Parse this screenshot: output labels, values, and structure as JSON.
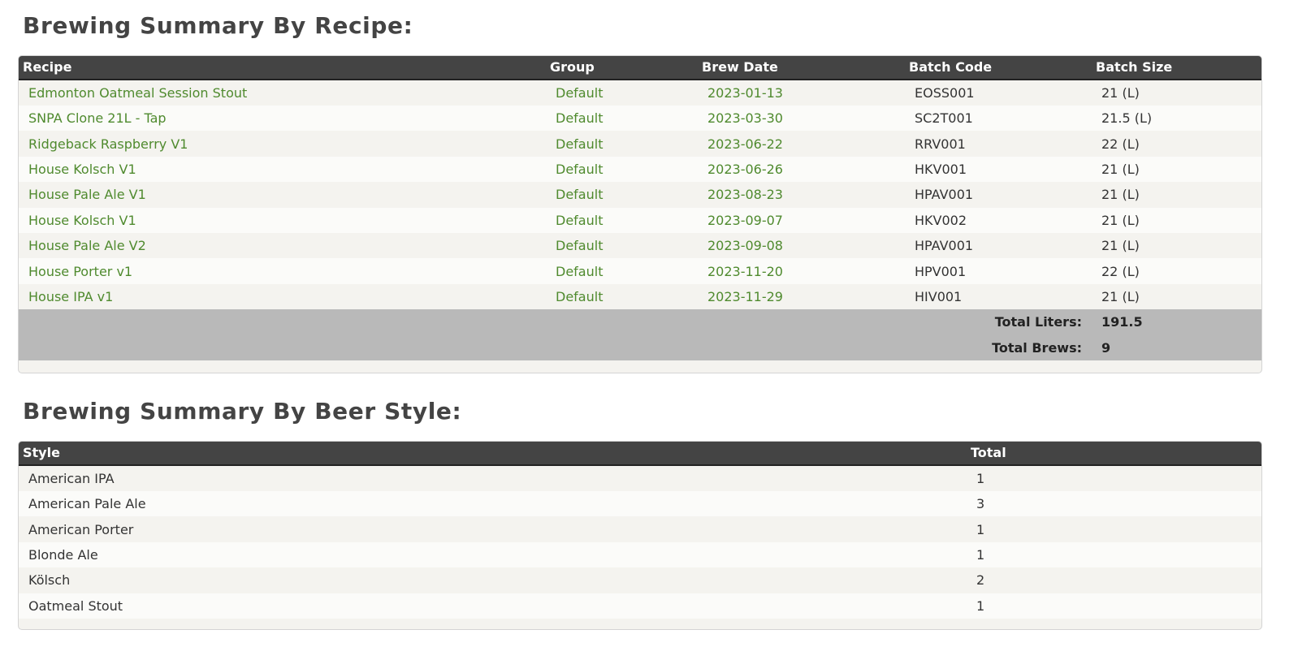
{
  "recipe_section": {
    "title": "Brewing Summary By Recipe:",
    "columns": {
      "recipe": "Recipe",
      "group": "Group",
      "brew_date": "Brew Date",
      "batch_code": "Batch Code",
      "batch_size": "Batch Size"
    },
    "rows": [
      {
        "recipe": "Edmonton Oatmeal Session Stout",
        "group": "Default",
        "brew_date": "2023-01-13",
        "batch_code": "EOSS001",
        "batch_size": "21 (L)"
      },
      {
        "recipe": "SNPA Clone 21L - Tap",
        "group": "Default",
        "brew_date": "2023-03-30",
        "batch_code": "SC2T001",
        "batch_size": "21.5 (L)"
      },
      {
        "recipe": "Ridgeback Raspberry V1",
        "group": "Default",
        "brew_date": "2023-06-22",
        "batch_code": "RRV001",
        "batch_size": "22 (L)"
      },
      {
        "recipe": "House Kolsch V1",
        "group": "Default",
        "brew_date": "2023-06-26",
        "batch_code": "HKV001",
        "batch_size": "21 (L)"
      },
      {
        "recipe": "House Pale Ale V1",
        "group": "Default",
        "brew_date": "2023-08-23",
        "batch_code": "HPAV001",
        "batch_size": "21 (L)"
      },
      {
        "recipe": "House Kolsch V1",
        "group": "Default",
        "brew_date": "2023-09-07",
        "batch_code": "HKV002",
        "batch_size": "21 (L)"
      },
      {
        "recipe": "House Pale Ale V2",
        "group": "Default",
        "brew_date": "2023-09-08",
        "batch_code": "HPAV001",
        "batch_size": "21 (L)"
      },
      {
        "recipe": "House Porter v1",
        "group": "Default",
        "brew_date": "2023-11-20",
        "batch_code": "HPV001",
        "batch_size": "22 (L)"
      },
      {
        "recipe": "House IPA v1",
        "group": "Default",
        "brew_date": "2023-11-29",
        "batch_code": "HIV001",
        "batch_size": "21 (L)"
      }
    ],
    "totals": {
      "liters_label": "Total Liters:",
      "liters_value": "191.5",
      "brews_label": "Total Brews:",
      "brews_value": "9"
    }
  },
  "style_section": {
    "title": "Brewing Summary By Beer Style:",
    "columns": {
      "style": "Style",
      "total": "Total"
    },
    "rows": [
      {
        "style": "American IPA",
        "total": "1"
      },
      {
        "style": "American Pale Ale",
        "total": "3"
      },
      {
        "style": "American Porter",
        "total": "1"
      },
      {
        "style": "Blonde Ale",
        "total": "1"
      },
      {
        "style": "Kölsch",
        "total": "2"
      },
      {
        "style": "Oatmeal Stout",
        "total": "1"
      }
    ]
  },
  "colors": {
    "link": "#4f8a2e",
    "header_bg": "#444444",
    "totals_bg": "#b9b9b9"
  }
}
